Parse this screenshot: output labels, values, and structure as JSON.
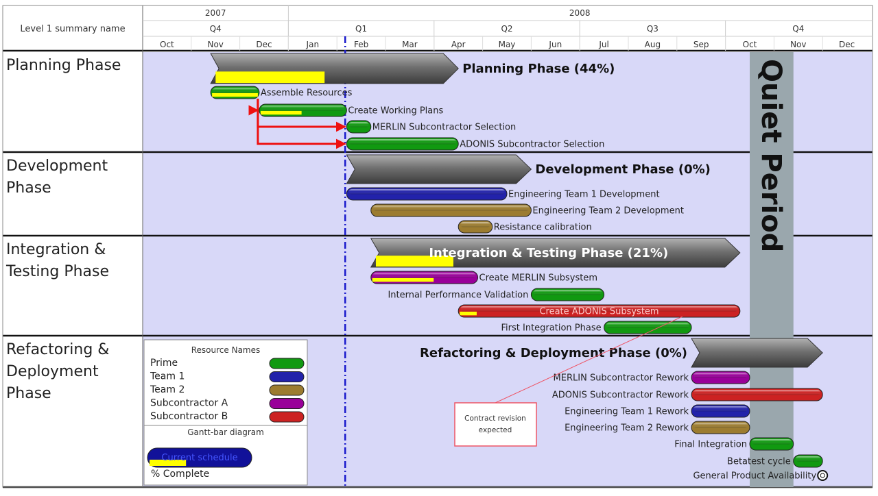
{
  "header": {
    "corner_label": "Level 1 summary name",
    "years": [
      "2007",
      "2008"
    ],
    "quarters": [
      "Q4",
      "Q1",
      "Q2",
      "Q3",
      "Q4"
    ],
    "months": [
      "Oct",
      "Nov",
      "Dec",
      "Jan",
      "Feb",
      "Mar",
      "Apr",
      "May",
      "Jun",
      "Jul",
      "Aug",
      "Sep",
      "Oct",
      "Nov",
      "Dec"
    ]
  },
  "phases": [
    {
      "name_lines": [
        "Planning Phase"
      ]
    },
    {
      "name_lines": [
        "Development",
        "Phase"
      ]
    },
    {
      "name_lines": [
        "Integration &",
        "Testing Phase"
      ]
    },
    {
      "name_lines": [
        "Refactoring &",
        "Deployment",
        "Phase"
      ]
    }
  ],
  "quiet_period": {
    "label": "Quiet Period",
    "start": 12.5,
    "end": 13.4
  },
  "today_marker": {
    "month": 4.17,
    "style": "dash-dot",
    "color": "#1a1acc"
  },
  "colors": {
    "background": "#d8d8f8",
    "summary": "#6a6a6a",
    "complete": "#ffff00",
    "quiet": "#9aa7ad",
    "arrow": "#ee1111",
    "callout": "#ee5566"
  },
  "resources": [
    {
      "name": "Prime",
      "color": "#119911"
    },
    {
      "name": "Team 1",
      "color": "#2222aa"
    },
    {
      "name": "Team 2",
      "color": "#9c7c30"
    },
    {
      "name": "Subcontractor A",
      "color": "#990099"
    },
    {
      "name": "Subcontractor B",
      "color": "#cc2222"
    }
  ],
  "legend": {
    "resource_title": "Resource Names",
    "diagram_title": "Gantt-bar diagram",
    "sample_label": "Current schedule",
    "sample_complete": 0.35,
    "percent_label": "% Complete"
  },
  "annotation": {
    "lines": [
      "Contract revision",
      "expected"
    ]
  },
  "chart_data": {
    "type": "gantt",
    "time_axis": {
      "unit": "month",
      "start": "Oct 2007",
      "end": "Dec 2008"
    },
    "summaries": [
      {
        "label": "Planning Phase (44%)",
        "start": 1.4,
        "end": 6.5,
        "complete": 0.44,
        "label_side": "right"
      },
      {
        "label": "Development Phase (0%)",
        "start": 4.2,
        "end": 8.0,
        "complete": 0,
        "label_side": "right"
      },
      {
        "label": "Integration & Testing Phase (21%)",
        "start": 4.7,
        "end": 12.3,
        "complete": 0.21,
        "label_side": "inside"
      },
      {
        "label": "Refactoring & Deployment Phase (0%)",
        "start": 11.3,
        "end": 14.0,
        "complete": 0,
        "label_side": "left"
      }
    ],
    "tasks": [
      {
        "label": "Assemble Resources",
        "phase": 0,
        "start": 1.4,
        "end": 2.4,
        "complete": 1.0,
        "resource": "Prime",
        "label_side": "right"
      },
      {
        "label": "Create Working Plans",
        "phase": 0,
        "start": 2.4,
        "end": 4.2,
        "complete": 0.5,
        "resource": "Prime",
        "label_side": "right"
      },
      {
        "label": "MERLIN Subcontractor Selection",
        "phase": 0,
        "start": 4.2,
        "end": 4.7,
        "complete": 0,
        "resource": "Prime",
        "label_side": "right"
      },
      {
        "label": "ADONIS Subcontractor Selection",
        "phase": 0,
        "start": 4.2,
        "end": 6.5,
        "complete": 0,
        "resource": "Prime",
        "label_side": "right"
      },
      {
        "label": "Engineering Team 1 Development",
        "phase": 1,
        "start": 4.2,
        "end": 7.5,
        "complete": 0,
        "resource": "Team 1",
        "label_side": "right"
      },
      {
        "label": "Engineering Team 2 Development",
        "phase": 1,
        "start": 4.7,
        "end": 8.0,
        "complete": 0,
        "resource": "Team 2",
        "label_side": "right"
      },
      {
        "label": "Resistance calibration",
        "phase": 1,
        "start": 6.5,
        "end": 7.2,
        "complete": 0,
        "resource": "Team 2",
        "label_side": "right"
      },
      {
        "label": "Create MERLIN Subsystem",
        "phase": 2,
        "start": 4.7,
        "end": 6.9,
        "complete": 0.6,
        "resource": "Subcontractor A",
        "label_side": "right"
      },
      {
        "label": "Internal Performance Validation",
        "phase": 2,
        "start": 8.0,
        "end": 9.5,
        "complete": 0,
        "resource": "Prime",
        "label_side": "left"
      },
      {
        "label": "Create ADONIS Subsystem",
        "phase": 2,
        "start": 6.5,
        "end": 12.3,
        "complete": 0.07,
        "resource": "Subcontractor B",
        "label_side": "inside"
      },
      {
        "label": "First Integration Phase",
        "phase": 2,
        "start": 9.5,
        "end": 11.3,
        "complete": 0,
        "resource": "Prime",
        "label_side": "left"
      },
      {
        "label": "MERLIN Subcontractor Rework",
        "phase": 3,
        "start": 11.3,
        "end": 12.5,
        "complete": 0,
        "resource": "Subcontractor A",
        "label_side": "left"
      },
      {
        "label": "ADONIS Subcontractor Rework",
        "phase": 3,
        "start": 11.3,
        "end": 14.0,
        "complete": 0,
        "resource": "Subcontractor B",
        "label_side": "left"
      },
      {
        "label": "Engineering Team 1 Rework",
        "phase": 3,
        "start": 11.3,
        "end": 12.5,
        "complete": 0,
        "resource": "Team 1",
        "label_side": "left"
      },
      {
        "label": "Engineering Team 2 Rework",
        "phase": 3,
        "start": 11.3,
        "end": 12.5,
        "complete": 0,
        "resource": "Team 2",
        "label_side": "left"
      },
      {
        "label": "Final Integration",
        "phase": 3,
        "start": 12.5,
        "end": 13.4,
        "complete": 0,
        "resource": "Prime",
        "label_side": "left"
      },
      {
        "label": "Betatest cycle",
        "phase": 3,
        "start": 13.4,
        "end": 14.0,
        "complete": 0,
        "resource": "Prime",
        "label_side": "left"
      }
    ],
    "milestones": [
      {
        "label": "General Product Availability",
        "month": 14.0,
        "label_side": "left"
      }
    ],
    "dependencies": [
      {
        "from": "Assemble Resources",
        "to": "Create Working Plans"
      },
      {
        "from": "Assemble Resources",
        "to": "MERLIN Subcontractor Selection"
      },
      {
        "from": "Assemble Resources",
        "to": "ADONIS Subcontractor Selection"
      }
    ]
  }
}
